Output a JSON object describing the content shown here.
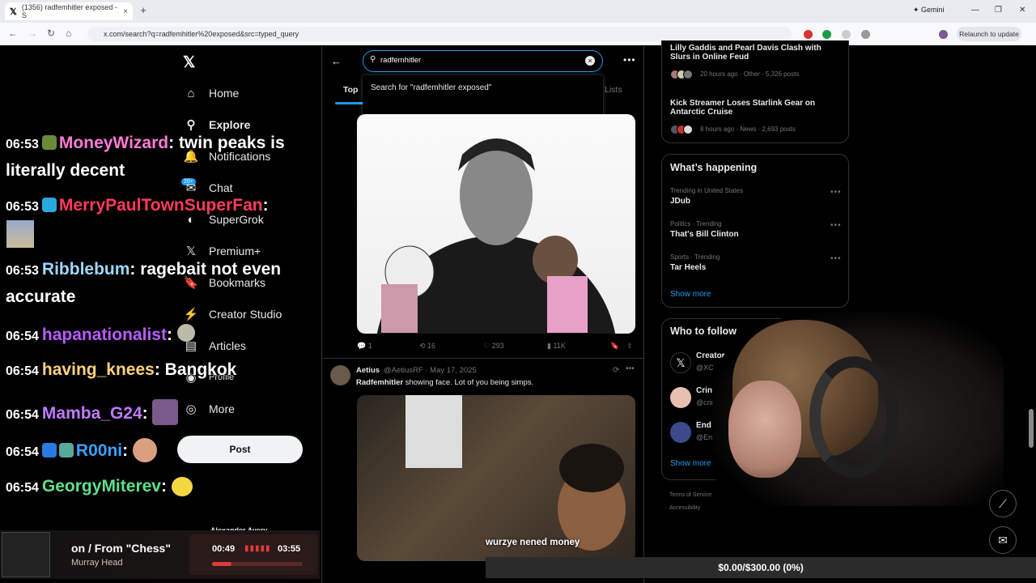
{
  "browser": {
    "tab_title": "(1356) radfemhitler exposed - S",
    "tab_close": "×",
    "new_tab": "+",
    "gemini_label": "Gemini",
    "url": "x.com/search?q=radfemhitler%20exposed&src=typed_query",
    "relaunch_label": "Relaunch to update",
    "back": "←",
    "forward": "→",
    "reload": "↻",
    "home": "⌂",
    "min": "—",
    "max": "❐",
    "close": "✕"
  },
  "sidebar": {
    "logo": "𝕏",
    "items": [
      {
        "icon": "⌂",
        "label": "Home"
      },
      {
        "icon": "⚲",
        "label": "Explore"
      },
      {
        "icon": "🔔",
        "label": "Notifications"
      },
      {
        "icon": "✉",
        "label": "Chat"
      },
      {
        "icon": "◐",
        "label": "SuperGrok"
      },
      {
        "icon": "𝕏",
        "label": "Premium+"
      },
      {
        "icon": "🔖",
        "label": "Bookmarks"
      },
      {
        "icon": "⚡",
        "label": "Creator Studio"
      },
      {
        "icon": "▤",
        "label": "Articles"
      },
      {
        "icon": "◉",
        "label": "Profile"
      },
      {
        "icon": "◎",
        "label": "More"
      }
    ],
    "chat_badge": "20+",
    "post_label": "Post",
    "user_name": "Alexander Avery"
  },
  "search": {
    "value": "radfemhitler",
    "suggestion": "Search for \"radfemhitler exposed\"",
    "clear": "×",
    "tabs": {
      "top": "Top",
      "lists": "Lists"
    }
  },
  "posts": [
    {
      "actions": {
        "replies": "1",
        "reposts": "16",
        "likes": "293",
        "views": "11K"
      }
    },
    {
      "name": "Aetius",
      "handle": "@AetiusRF · May 17, 2025",
      "text_bold": "Radfemhitler",
      "text": " showing face. Lot of you being simps.",
      "caption": "wurzye nened money"
    }
  ],
  "trending_top": [
    {
      "title": "Lilly Gaddis and Pearl Davis Clash with Slurs in Online Feud",
      "meta": "20 hours ago · Other · 5,326 posts"
    },
    {
      "title": "Kick Streamer Loses Starlink Gear on Antarctic Cruise",
      "meta": "8 hours ago · News · 2,693 posts"
    }
  ],
  "whats_happening": {
    "heading": "What’s happening",
    "items": [
      {
        "label": "Trending in United States",
        "name": "JDub"
      },
      {
        "label": "Politics · Trending",
        "name": "That's Bill Clinton"
      },
      {
        "label": "Sports · Trending",
        "name": "Tar Heels"
      }
    ],
    "show_more": "Show more"
  },
  "who_to_follow": {
    "heading": "Who to follow",
    "items": [
      {
        "name": "Creator",
        "handle": "@XC"
      },
      {
        "name": "Cringe Pa",
        "handle": "@cringe_p"
      },
      {
        "name": "End Woke",
        "handle": "@EndWo"
      }
    ],
    "show_more": "Show more"
  },
  "footer": {
    "line1": "Terms of Service",
    "line2": "Accessibility"
  },
  "stream_chat": [
    {
      "time": "06:53",
      "user": "MoneyWizard",
      "color": "#ff7ad9",
      "msg": "twin peaks is",
      "msg2": "literally decent"
    },
    {
      "time": "06:53",
      "user": "MerryPaulTownSuperFan",
      "color": "#ff3b5c",
      "msg": ""
    },
    {
      "time": "06:53",
      "user": "Ribblebum",
      "color": "#9fd7ff",
      "msg": "ragebait not even",
      "msg2": "accurate"
    },
    {
      "time": "06:54",
      "user": "hapanationalist",
      "color": "#b85cff",
      "msg": ""
    },
    {
      "time": "06:54",
      "user": "having_knees",
      "color": "#ffd27a",
      "msg": "Bangkok"
    },
    {
      "time": "06:54",
      "user": "Mamba_G24",
      "color": "#c07aff",
      "msg": ""
    },
    {
      "time": "06:54",
      "user": "R00ni",
      "color": "#3aa0ff",
      "msg": ""
    },
    {
      "time": "06:54",
      "user": "GeorgyMiterev",
      "color": "#5fe08a",
      "msg": ""
    }
  ],
  "music": {
    "title": "on / From \"Chess\"",
    "artist": "Murray Head",
    "current": "00:49",
    "end": "03:55",
    "progress": 0.21,
    "bars": "▮▮▮▮▮"
  },
  "donation": {
    "text": "$0.00/$300.00 (0%)"
  }
}
